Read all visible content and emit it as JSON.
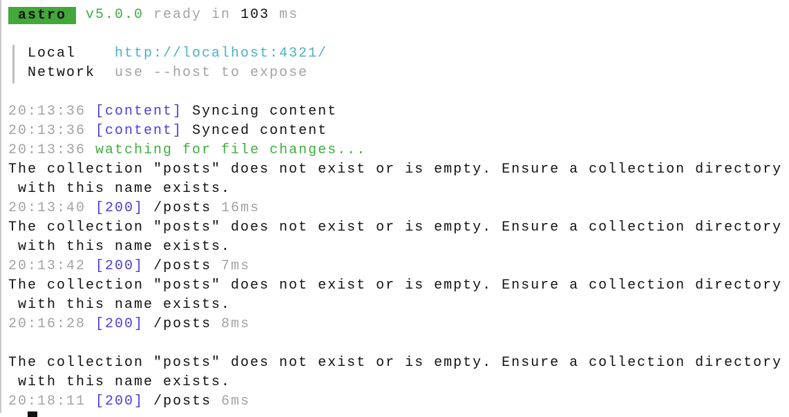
{
  "header": {
    "badge": "astro",
    "version": "v5.0.0",
    "ready_text": "ready in",
    "ready_time": "103",
    "ready_unit": "ms"
  },
  "server_info": {
    "local_label": "Local",
    "local_url": "http://localhost:4321/",
    "network_label": "Network",
    "network_hint": "use --host to expose"
  },
  "colors": {
    "badge_bg": "#44a73a",
    "green": "#3fae3f",
    "tag_blue": "#4b3edc",
    "url_cyan": "#4bb1c3",
    "muted_gray": "#a3a3a3"
  },
  "log": [
    {
      "time": "20:13:36",
      "tag": "[content]",
      "msg": "Syncing content"
    },
    {
      "time": "20:13:36",
      "tag": "[content]",
      "msg": "Synced content"
    },
    {
      "time": "20:13:36",
      "green_msg": "watching for file changes..."
    },
    {
      "warning_1": "The collection \"posts\" does not exist or is empty. Ensure a collection directory",
      "warning_2": " with this name exists."
    },
    {
      "time": "20:13:40",
      "tag": "[200]",
      "msg": "/posts",
      "dur": "16ms"
    },
    {
      "warning_1": "The collection \"posts\" does not exist or is empty. Ensure a collection directory",
      "warning_2": " with this name exists."
    },
    {
      "time": "20:13:42",
      "tag": "[200]",
      "msg": "/posts",
      "dur": "7ms"
    },
    {
      "warning_1": "The collection \"posts\" does not exist or is empty. Ensure a collection directory",
      "warning_2": " with this name exists."
    },
    {
      "time": "20:16:28",
      "tag": "[200]",
      "msg": "/posts",
      "dur": "8ms"
    },
    {
      "warning_1": "The collection \"posts\" does not exist or is empty. Ensure a collection directory",
      "warning_2": " with this name exists."
    },
    {
      "time": "20:18:11",
      "tag": "[200]",
      "msg": "/posts",
      "dur": "6ms"
    }
  ]
}
